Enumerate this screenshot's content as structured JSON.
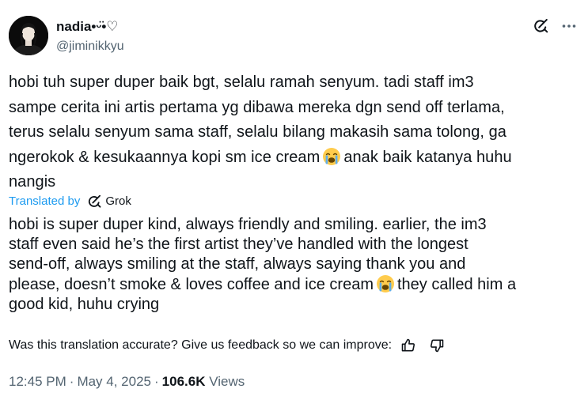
{
  "author": {
    "display_name": "nadia•ᵕ̈•♡",
    "handle": "@jiminikkyu"
  },
  "tweet": {
    "lines": [
      "hobi tuh super duper baik bgt, selalu ramah senyum. tadi staff im3",
      "sampe cerita ini artis pertama yg dibawa mereka dgn send off terlama,",
      "terus selalu senyum sama staff, selalu bilang makasih sama tolong, ga"
    ],
    "line4_before_emoji": "ngerokok & kesukaannya kopi sm ice cream",
    "line4_after_emoji": "anak baik katanya huhu",
    "line5": "nangis"
  },
  "translation": {
    "translated_by_label": "Translated by",
    "provider": "Grok",
    "lines": [
      "hobi is super duper kind, always friendly and smiling. earlier, the im3",
      "staff even said he’s the first artist they’ve handled with the longest",
      "send-off, always smiling at the staff, always saying thank you and"
    ],
    "line4_before_emoji": "please, doesn’t smoke & loves coffee and ice cream",
    "line4_after_emoji": "they called him a",
    "line5": "good kid, huhu crying"
  },
  "feedback": {
    "prompt": "Was this translation accurate? Give us feedback so we can improve:"
  },
  "meta": {
    "time": "12:45 PM",
    "date": "May 4, 2025",
    "views_count": "106.6K",
    "views_label": "Views",
    "separator": "·"
  },
  "icons": {
    "grok": "grok-icon",
    "more": "more-icon",
    "thumbs_up": "thumbs-up-icon",
    "thumbs_down": "thumbs-down-icon",
    "emoji": "loudly-crying-face-emoji"
  },
  "colors": {
    "text": "#0f1419",
    "secondary": "#536471",
    "link": "#1d9bf0"
  }
}
